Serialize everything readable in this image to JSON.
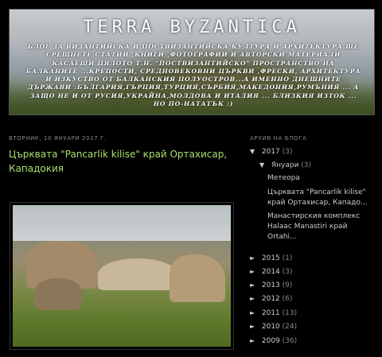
{
  "header": {
    "title": "TERRA BYZANTICA",
    "description": "БЛОГ ЗА ВИЗАНТИЙСКА И ПОСТВИЗАНТИЙСКА КУЛТУРА И АРХИТЕКТУРА.ЩЕ СРЕЩНЕТЕ СТАТИИ ,КНИГИ ,ФОТОГРАФИИ И АВТОРСКИ МАТЕРИАЛИ КАСАЕЩИ ЦЯЛОТО Т.Н. \"ПОСТВИЗАНТИЙСКО\" ПРОСТРАНСТВО НА БАЛКАНИТЕ ...КРЕПОСТИ, СРЕДНОВЕКОВНИ ЦЪРКВИ ,ФРЕСКИ, АРХИТЕКТУРА И ИЗКУСТВО ОТ БАЛКАНСКИЯ ПОЛУОСТРОВ...А ИМЕННО ДНЕШНИТЕ ДЪРЖАВИ :БЪЛГАРИЯ,ГЪРЦИЯ,ТУРЦИЯ,СЪРБИЯ,МАКЕДОНИЯ,РУМЪНИЯ ... А ЗАЩО НЕ И ОТ РУСИЯ,УКРАЙНА,МОЛДОВА И ИТАЛИЯ ... БЛИЗКИЯ ИЗТОК ... НО ПО-НАТАТЪК :)"
  },
  "post": {
    "date": "ВТОРНИК, 10 ЯНУАРИ 2017 Г.",
    "title": "Църквата \"Pancarlik kilise\" край Ортахисар, Кападокия"
  },
  "sidebar": {
    "archive_title": "АРХИВ НА БЛОГА",
    "year_2017": {
      "label": "2017",
      "count": "(3)",
      "toggle": "▼"
    },
    "month_jan": {
      "label": "Януари",
      "count": "(3)",
      "toggle": "▼"
    },
    "posts": [
      "Метеора",
      "Църквата \"Pancarlik kilise\" край Ортахисар, Кападо...",
      "Манастирския комплекс Halaac Manastiri край Ortahi..."
    ],
    "years": [
      {
        "label": "2015",
        "count": "(1)",
        "toggle": "►"
      },
      {
        "label": "2014",
        "count": "(3)",
        "toggle": "►"
      },
      {
        "label": "2013",
        "count": "(9)",
        "toggle": "►"
      },
      {
        "label": "2012",
        "count": "(6)",
        "toggle": "►"
      },
      {
        "label": "2011",
        "count": "(13)",
        "toggle": "►"
      },
      {
        "label": "2010",
        "count": "(24)",
        "toggle": "►"
      },
      {
        "label": "2009",
        "count": "(36)",
        "toggle": "►"
      }
    ]
  },
  "colors": {
    "background": "#000000",
    "post_title": "#a6e06b",
    "muted_text": "#888888"
  }
}
